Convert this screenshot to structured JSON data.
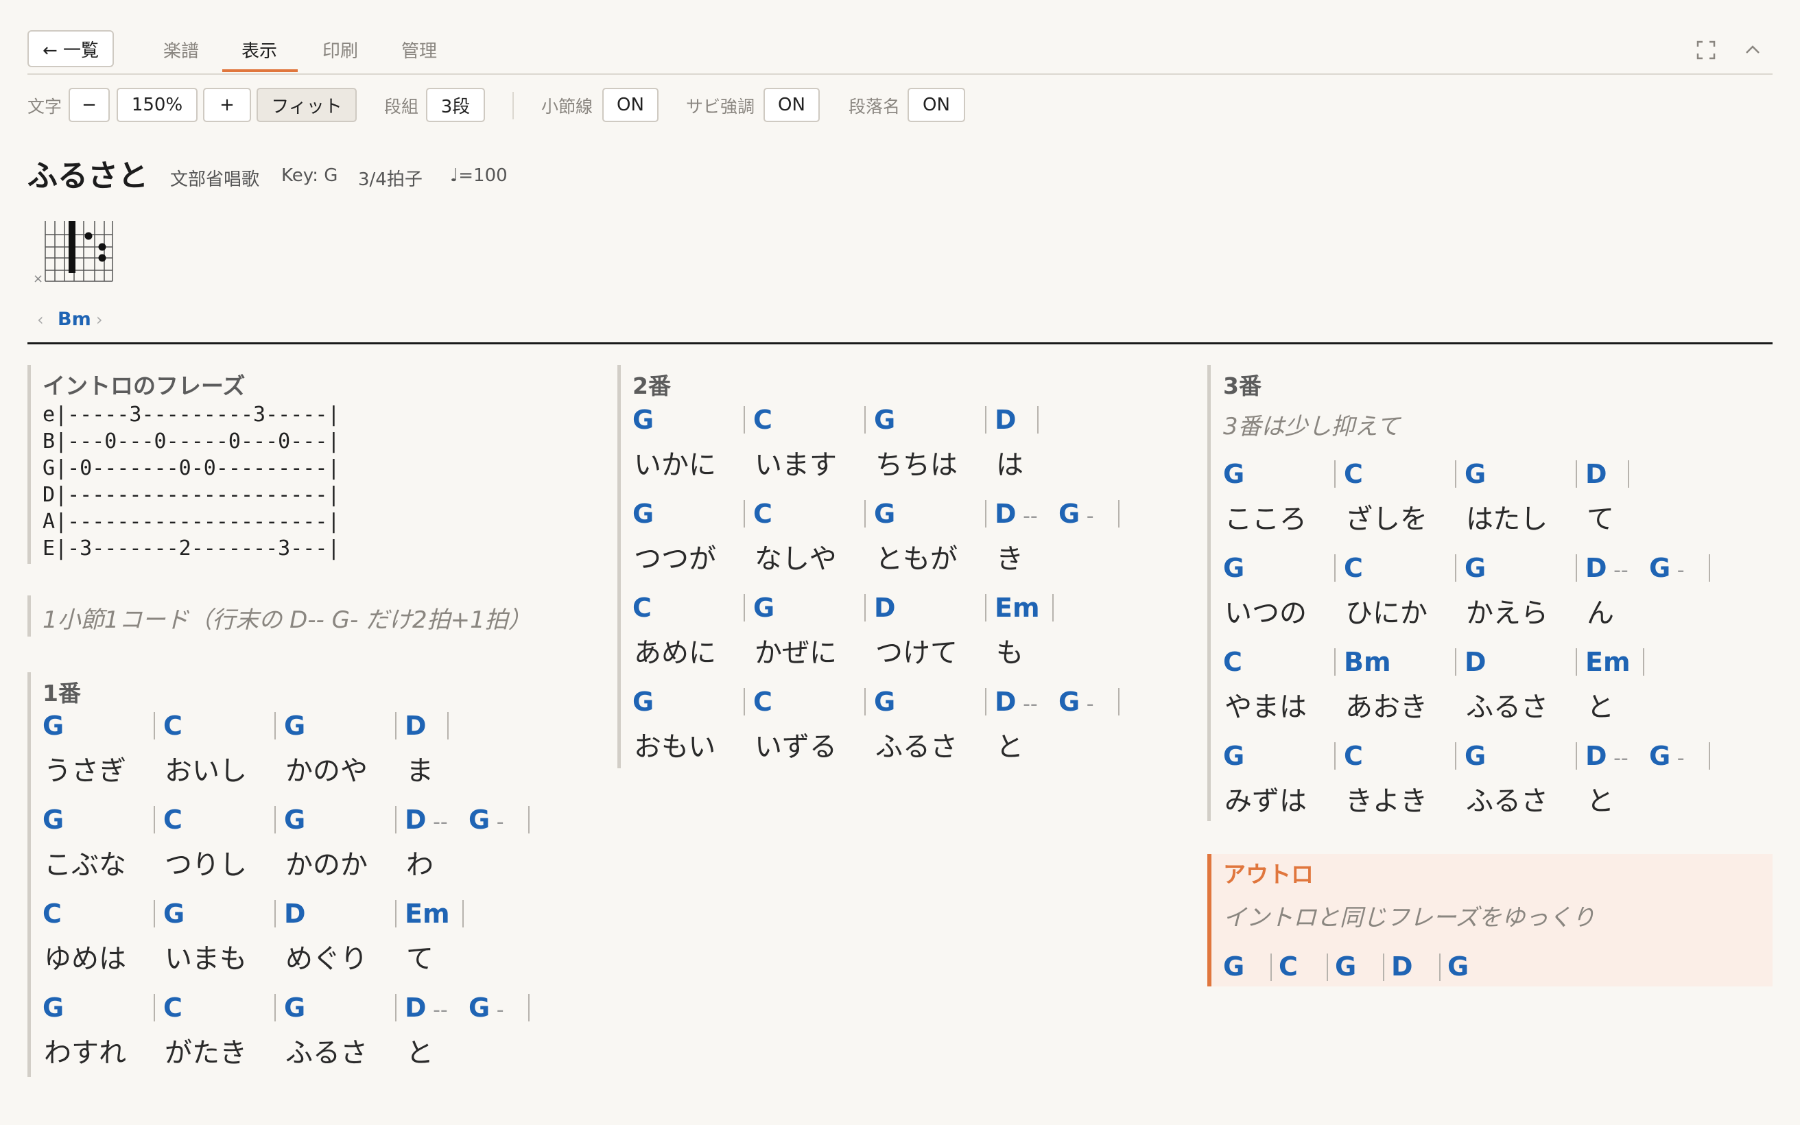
{
  "nav": {
    "back_label": "← 一覧",
    "tabs": [
      "楽譜",
      "表示",
      "印刷",
      "管理"
    ],
    "active_tab": "表示"
  },
  "toolbar": {
    "font_label": "文字",
    "minus": "−",
    "zoom": "150%",
    "plus": "+",
    "fit": "フィット",
    "columns_label": "段組",
    "columns": "3段",
    "barlines_label": "小節線",
    "barlines": "ON",
    "chorus_label": "サビ強調",
    "chorus": "ON",
    "section_names_label": "段落名",
    "section_names": "ON"
  },
  "song": {
    "title": "ふるさと",
    "composer": "文部省唱歌",
    "key": "Key: G",
    "time": "3/4拍子",
    "tempo": "♩=100"
  },
  "chord_diagram": {
    "name": "Bm",
    "prev": "‹",
    "next": "›",
    "muted": "×"
  },
  "sections": {
    "intro": {
      "title": "イントロのフレーズ",
      "tab": [
        "e|-----3---------3-----|",
        "B|---0---0-----0---0---|",
        "G|-0-------0-0---------|",
        "D|---------------------|",
        "A|---------------------|",
        "E|-3-------2-------3---|"
      ]
    },
    "note": "1小節1コード（行末の D-- G- だけ2拍+1拍）",
    "v1": {
      "title": "1番",
      "lines": [
        {
          "chords": [
            "G",
            "C",
            "G",
            "D"
          ],
          "lyrics": [
            "うさぎ",
            "おいし",
            "かのや",
            "ま"
          ]
        },
        {
          "chords": [
            "G",
            "C",
            "G",
            "D",
            "G"
          ],
          "lyrics": [
            "こぶな",
            "つりし",
            "かのか",
            "わ"
          ]
        },
        {
          "chords": [
            "C",
            "G",
            "D",
            "Em"
          ],
          "lyrics": [
            "ゆめは",
            "いまも",
            "めぐり",
            "て"
          ]
        },
        {
          "chords": [
            "G",
            "C",
            "G",
            "D",
            "G"
          ],
          "lyrics": [
            "わすれ",
            "がたき",
            "ふるさ",
            "と"
          ]
        }
      ]
    },
    "v2": {
      "title": "2番",
      "lines": [
        {
          "chords": [
            "G",
            "C",
            "G",
            "D"
          ],
          "lyrics": [
            "いかに",
            "います",
            "ちちは",
            "は"
          ]
        },
        {
          "chords": [
            "G",
            "C",
            "G",
            "D",
            "G"
          ],
          "lyrics": [
            "つつが",
            "なしや",
            "ともが",
            "き"
          ]
        },
        {
          "chords": [
            "C",
            "G",
            "D",
            "Em"
          ],
          "lyrics": [
            "あめに",
            "かぜに",
            "つけて",
            "も"
          ]
        },
        {
          "chords": [
            "G",
            "C",
            "G",
            "D",
            "G"
          ],
          "lyrics": [
            "おもい",
            "いずる",
            "ふるさ",
            "と"
          ]
        }
      ]
    },
    "v3": {
      "title": "3番",
      "note": "3番は少し抑えて",
      "lines": [
        {
          "chords": [
            "G",
            "C",
            "G",
            "D"
          ],
          "lyrics": [
            "こころ",
            "ざしを",
            "はたし",
            "て"
          ]
        },
        {
          "chords": [
            "G",
            "C",
            "G",
            "D",
            "G"
          ],
          "lyrics": [
            "いつの",
            "ひにか",
            "かえら",
            "ん"
          ]
        },
        {
          "chords": [
            "C",
            "Bm",
            "D",
            "Em"
          ],
          "lyrics": [
            "やまは",
            "あおき",
            "ふるさ",
            "と"
          ]
        },
        {
          "chords": [
            "G",
            "C",
            "G",
            "D",
            "G"
          ],
          "lyrics": [
            "みずは",
            "きよき",
            "ふるさ",
            "と"
          ]
        }
      ]
    },
    "outro": {
      "title": "アウトロ",
      "note": "イントロと同じフレーズをゆっくり",
      "chords": [
        "G",
        "C",
        "G",
        "D",
        "G"
      ]
    },
    "dash2": "--",
    "dash1": "-"
  },
  "colors": {
    "chord": "#1f64b4",
    "accent": "#e0763d",
    "outro_bg": "#fbeee7"
  }
}
